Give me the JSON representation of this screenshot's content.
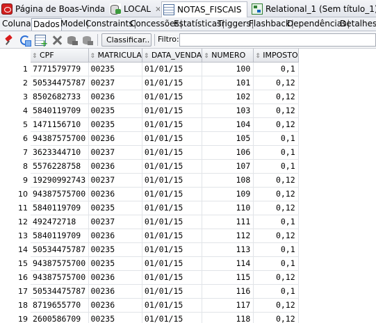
{
  "editor_tabs": [
    {
      "label": "Página de Boas-Vindas",
      "icon": "oracle-database-icon"
    },
    {
      "label": "LOCAL",
      "icon": "connection-icon"
    },
    {
      "label": "NOTAS_FISCAIS",
      "icon": "table-icon",
      "active": true
    },
    {
      "label": "Relational_1 (Sem título_1)",
      "icon": "relational-model-icon"
    }
  ],
  "sub_tabs": [
    "Colunas",
    "Dados",
    "Model",
    "Constraints",
    "Concessões",
    "Estatísticas",
    "Triggers",
    "Flashback",
    "Dependências",
    "Detalhes"
  ],
  "active_sub_tab": "Dados",
  "toolbar": {
    "icons": [
      "pin-icon",
      "refresh-icon",
      "insert-row-icon",
      "delete-row-icon",
      "commit-icon",
      "rollback-icon"
    ],
    "sort_label": "Classificar..",
    "filter_label": "Filtro:",
    "filter_value": ""
  },
  "grid": {
    "columns": [
      "CPF",
      "MATRICULA",
      "DATA_VENDA",
      "NUMERO",
      "IMPOSTO"
    ],
    "rows": [
      [
        "1",
        "7771579779",
        "00235",
        "01/01/15",
        "100",
        "0,1"
      ],
      [
        "2",
        "50534475787",
        "00237",
        "01/01/15",
        "101",
        "0,12"
      ],
      [
        "3",
        "8502682733",
        "00236",
        "01/01/15",
        "102",
        "0,12"
      ],
      [
        "4",
        "5840119709",
        "00235",
        "01/01/15",
        "103",
        "0,12"
      ],
      [
        "5",
        "1471156710",
        "00235",
        "01/01/15",
        "104",
        "0,12"
      ],
      [
        "6",
        "94387575700",
        "00236",
        "01/01/15",
        "105",
        "0,1"
      ],
      [
        "7",
        "3623344710",
        "00237",
        "01/01/15",
        "106",
        "0,1"
      ],
      [
        "8",
        "5576228758",
        "00236",
        "01/01/15",
        "107",
        "0,1"
      ],
      [
        "9",
        "19290992743",
        "00237",
        "01/01/15",
        "108",
        "0,12"
      ],
      [
        "10",
        "94387575700",
        "00236",
        "01/01/15",
        "109",
        "0,12"
      ],
      [
        "11",
        "5840119709",
        "00235",
        "01/01/15",
        "110",
        "0,12"
      ],
      [
        "12",
        "492472718",
        "00237",
        "01/01/15",
        "111",
        "0,1"
      ],
      [
        "13",
        "5840119709",
        "00236",
        "01/01/15",
        "112",
        "0,12"
      ],
      [
        "14",
        "50534475787",
        "00235",
        "01/01/15",
        "113",
        "0,1"
      ],
      [
        "15",
        "94387575700",
        "00235",
        "01/01/15",
        "114",
        "0,1"
      ],
      [
        "16",
        "94387575700",
        "00236",
        "01/01/15",
        "115",
        "0,12"
      ],
      [
        "17",
        "50534475787",
        "00236",
        "01/01/15",
        "116",
        "0,1"
      ],
      [
        "18",
        "8719655770",
        "00236",
        "01/01/15",
        "117",
        "0,12"
      ],
      [
        "19",
        "2600586709",
        "00235",
        "01/01/15",
        "118",
        "0,12"
      ]
    ]
  }
}
